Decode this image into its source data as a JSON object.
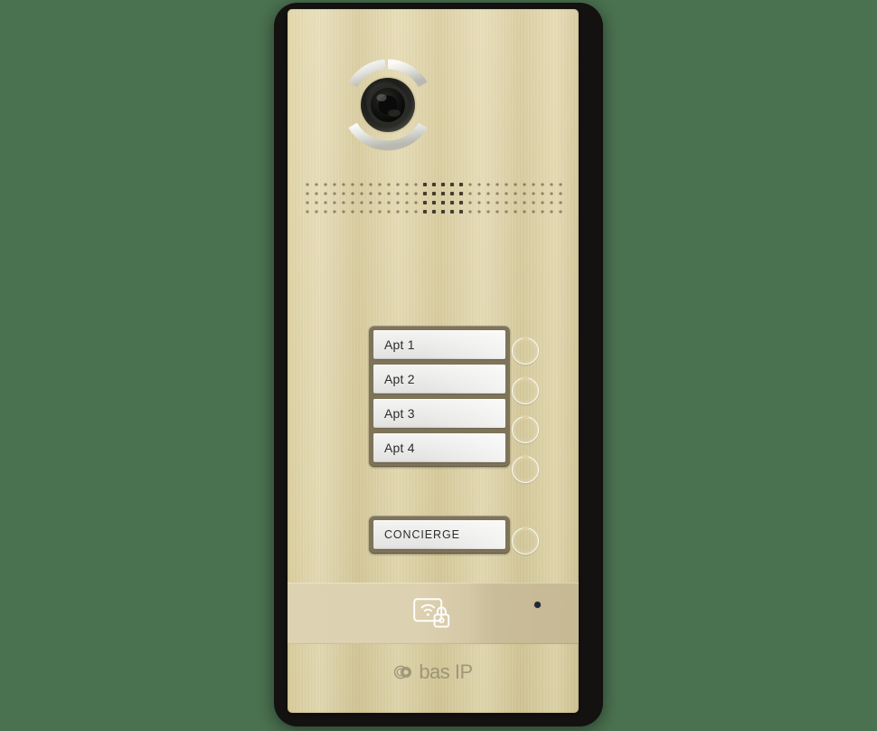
{
  "device": {
    "name": "BAS-IP multi-apartment IP video door station",
    "brand": "bas IP",
    "panel_finish_color": "#ded2a4",
    "frame_color": "#131210",
    "background_color": "#4a7150",
    "bezel_color": "#7f7459",
    "nameplate_color": "#ececea",
    "call_button_color": "#ffffff",
    "led_color": "#1e2a3a"
  },
  "camera": {
    "name": "camera-lens-module",
    "ring_segments": 3,
    "lens_color": "#1b1b1b",
    "ring_color": "#e9e9e6"
  },
  "speaker": {
    "name": "speaker-grille",
    "rows": 4,
    "columns": 29,
    "emphasis_columns": [
      13,
      14,
      15,
      16,
      17
    ]
  },
  "apartment_buttons": [
    {
      "label": "Apt 1",
      "call_button": "call-button-apt-1"
    },
    {
      "label": "Apt 2",
      "call_button": "call-button-apt-2"
    },
    {
      "label": "Apt 3",
      "call_button": "call-button-apt-3"
    },
    {
      "label": "Apt 4",
      "call_button": "call-button-apt-4"
    }
  ],
  "concierge": {
    "label": "CONCIERGE",
    "call_button": "call-button-concierge"
  },
  "rfid": {
    "name": "rfid-reader-zone",
    "icon": "rfid-card-lock-icon",
    "icon_parts": [
      "card",
      "wifi-waves",
      "padlock"
    ],
    "led": "status-led"
  },
  "logo": {
    "icon": "bas-ip-circle-icon",
    "text": "bas IP"
  }
}
